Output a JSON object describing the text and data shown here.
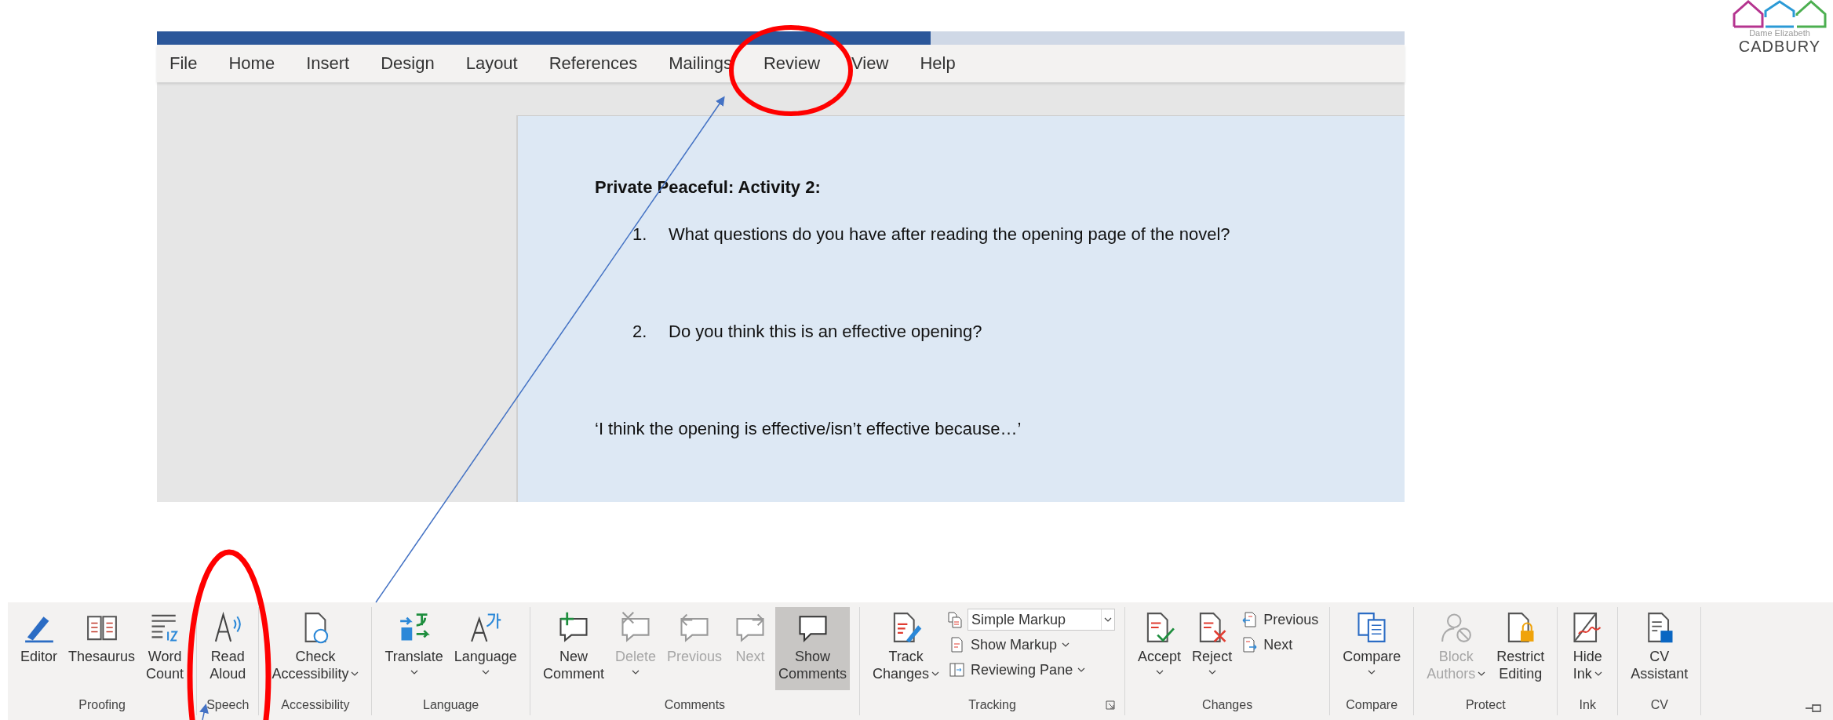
{
  "menu_tabs": [
    {
      "label": "File"
    },
    {
      "label": "Home"
    },
    {
      "label": "Insert"
    },
    {
      "label": "Design"
    },
    {
      "label": "Layout"
    },
    {
      "label": "References"
    },
    {
      "label": "Mailings"
    },
    {
      "label": "Review"
    },
    {
      "label": "View"
    },
    {
      "label": "Help"
    }
  ],
  "document": {
    "heading": "Private Peaceful: Activity 2:",
    "list": [
      {
        "number": "1.",
        "text": "What questions do you have after reading the opening page of the novel?"
      },
      {
        "number": "2.",
        "text": "Do you think this is an effective opening?"
      }
    ],
    "sentence": "‘I think the opening is effective/isn’t effective because…’"
  },
  "logo": {
    "tagline": "Dame Elizabeth",
    "name": "CADBURY"
  },
  "ribbon": {
    "groups": [
      {
        "label": "Proofing",
        "items": [
          {
            "kind": "large",
            "lines": [
              "Editor"
            ]
          },
          {
            "kind": "large",
            "lines": [
              "Thesaurus"
            ]
          },
          {
            "kind": "large",
            "lines": [
              "Word",
              "Count"
            ]
          }
        ]
      },
      {
        "label": "Speech",
        "items": [
          {
            "kind": "large",
            "lines": [
              "Read",
              "Aloud"
            ]
          }
        ]
      },
      {
        "label": "Accessibility",
        "items": [
          {
            "kind": "large",
            "lines": [
              "Check",
              "Accessibility"
            ],
            "dropdown": true
          }
        ]
      },
      {
        "label": "Language",
        "items": [
          {
            "kind": "large",
            "lines": [
              "Translate"
            ],
            "dropdown": true
          },
          {
            "kind": "large",
            "lines": [
              "Language"
            ],
            "dropdown": true
          }
        ]
      },
      {
        "label": "Comments",
        "items": [
          {
            "kind": "large",
            "lines": [
              "New",
              "Comment"
            ],
            "disabled": false,
            "on": false
          },
          {
            "kind": "large",
            "lines": [
              "Delete"
            ],
            "dropdown": true,
            "disabled": true,
            "on": false
          },
          {
            "kind": "large",
            "lines": [
              "Previous"
            ],
            "disabled": true,
            "on": false
          },
          {
            "kind": "large",
            "lines": [
              "Next"
            ],
            "disabled": true,
            "on": false
          },
          {
            "kind": "large",
            "lines": [
              "Show",
              "Comments"
            ],
            "disabled": false,
            "on": true
          }
        ]
      },
      {
        "label": "Tracking",
        "launcher": true,
        "items": [
          {
            "kind": "large",
            "lines": [
              "Track",
              "Changes"
            ],
            "dropdown": true
          },
          {
            "kind": "stack",
            "items": [
              {
                "kind": "select",
                "value": "Simple Markup"
              },
              {
                "kind": "small",
                "label": "Show Markup",
                "dropdown": true
              },
              {
                "kind": "small",
                "label": "Reviewing Pane",
                "dropdown": true
              }
            ]
          }
        ]
      },
      {
        "label": "Changes",
        "items": [
          {
            "kind": "large",
            "lines": [
              "Accept"
            ],
            "dropdown": true
          },
          {
            "kind": "large",
            "lines": [
              "Reject"
            ],
            "dropdown": true
          },
          {
            "kind": "stack",
            "items": [
              {
                "kind": "small",
                "label": "Previous"
              },
              {
                "kind": "small",
                "label": "Next"
              }
            ]
          }
        ]
      },
      {
        "label": "Compare",
        "items": [
          {
            "kind": "large",
            "lines": [
              "Compare"
            ],
            "dropdown": true
          }
        ]
      },
      {
        "label": "Protect",
        "items": [
          {
            "kind": "large",
            "lines": [
              "Block",
              "Authors"
            ],
            "dropdown": true,
            "disabled": true
          },
          {
            "kind": "large",
            "lines": [
              "Restrict",
              "Editing"
            ],
            "disabled": false
          }
        ]
      },
      {
        "label": "Ink",
        "items": [
          {
            "kind": "large",
            "lines": [
              "Hide",
              "Ink"
            ],
            "dropdown": true
          }
        ]
      },
      {
        "label": "CV",
        "items": [
          {
            "kind": "large",
            "lines": [
              "CV",
              "Assistant"
            ]
          }
        ]
      }
    ]
  }
}
